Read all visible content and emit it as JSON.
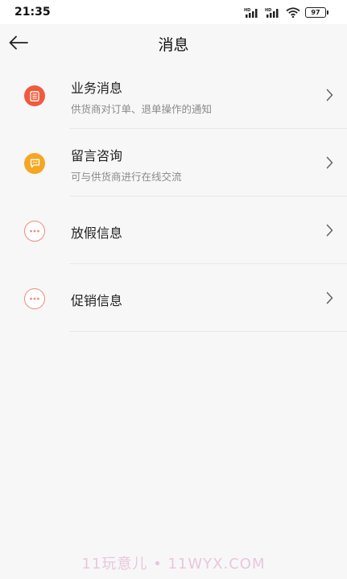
{
  "status_bar": {
    "time": "21:35",
    "battery": "97",
    "icons": [
      "hd-signal-icon",
      "hd-signal-icon",
      "wifi-icon",
      "battery-icon"
    ]
  },
  "nav": {
    "title": "消息",
    "back_icon": "back-arrow-icon"
  },
  "items": [
    {
      "title": "业务消息",
      "subtitle": "供货商对订单、退单操作的通知",
      "icon": "document-icon",
      "color": "#f05a3e"
    },
    {
      "title": "留言咨询",
      "subtitle": "可与供货商进行在线交流",
      "icon": "chat-icon",
      "color": "#f5a623"
    },
    {
      "title": "放假信息",
      "subtitle": "",
      "icon": "more-dots-icon",
      "color": "#f28b7a"
    },
    {
      "title": "促销信息",
      "subtitle": "",
      "icon": "more-dots-icon",
      "color": "#f28b7a"
    }
  ],
  "watermark": "11玩意儿 • 11WYX.COM"
}
